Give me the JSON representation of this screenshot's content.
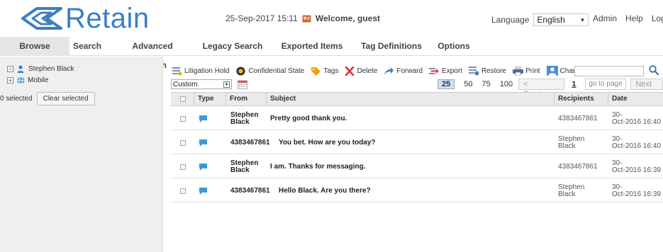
{
  "header": {
    "app_name": "Retain",
    "datetime": "25-Sep-2017 15:11",
    "welcome": "Welcome, guest",
    "language_label": "Language",
    "language_value": "English",
    "links": [
      "Admin",
      "Help",
      "Logout"
    ]
  },
  "nav": {
    "tabs": [
      "Browse",
      "Search",
      "Advanced Search",
      "Legacy Search",
      "Exported Items",
      "Tag Definitions",
      "Options"
    ],
    "active": "Browse"
  },
  "tree": {
    "user": "Stephen Black",
    "child": "Mobile",
    "selected_text": "0 selected",
    "clear_label": "Clear selected"
  },
  "toolbar": {
    "items": [
      "Litigation Hold",
      "Confidential State",
      "Tags",
      "Delete",
      "Forward",
      "Export",
      "Restore",
      "Print",
      "Change Mailbox"
    ]
  },
  "filter": {
    "selected": "Custom"
  },
  "pager": {
    "sizes": [
      "25",
      "50",
      "75",
      "100"
    ],
    "active_size": "25",
    "previous": "< Previous",
    "page": "1",
    "goto_placeholder": "go to page",
    "next": "Next >"
  },
  "table": {
    "columns": [
      "Type",
      "From",
      "Subject",
      "Recipients",
      "Date"
    ],
    "rows": [
      {
        "from": "Stephen Black",
        "subject": "Pretty good thank you.",
        "recipients": "4383467861",
        "date_top": "30-",
        "date_bottom": "Oct-2016 16:40"
      },
      {
        "from": "4383467861",
        "subject": "You bet. How are you today?",
        "recipients": "Stephen Black",
        "date_top": "30-",
        "date_bottom": "Oct-2016 16:40"
      },
      {
        "from": "Stephen Black",
        "subject": "I am. Thanks for messaging.",
        "recipients": "4383467861",
        "date_top": "30-",
        "date_bottom": "Oct-2016 16:39"
      },
      {
        "from": "4383467861",
        "subject": "Hello Black. Are you there?",
        "recipients": "Stephen Black",
        "date_top": "30-",
        "date_bottom": "Oct-2016 16:39"
      }
    ]
  },
  "colors": {
    "brand": "#3b7fc4",
    "nav_active_bg": "#e6e6e6",
    "panel_bg": "#efefef",
    "header_row_bg": "#eaeaea",
    "message_icon": "#3d9ad9"
  }
}
